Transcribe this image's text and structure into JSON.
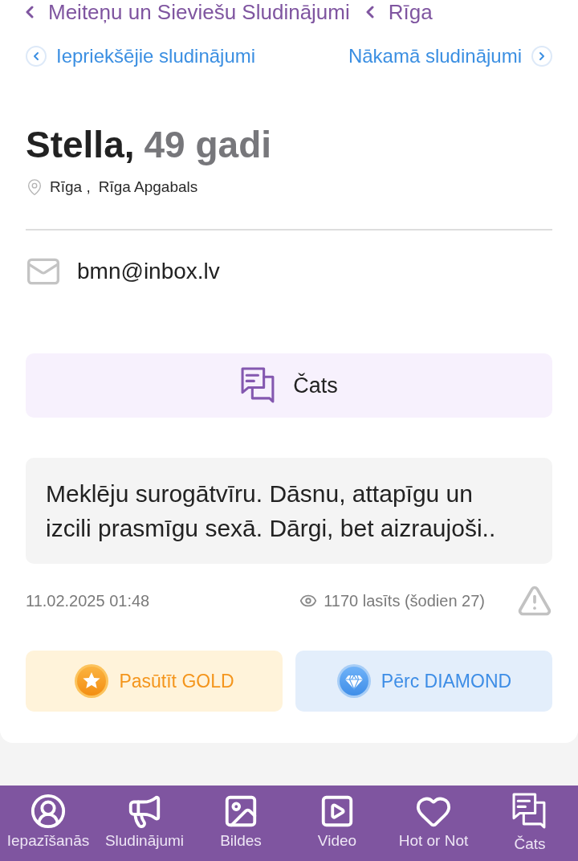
{
  "breadcrumb": [
    {
      "label": "Meiteņu un Sieviešu Sludinājumi"
    },
    {
      "label": "Rīga"
    }
  ],
  "pager": {
    "previous": "Iepriekšējie sludinājumi",
    "next": "Nākamā sludinājumi"
  },
  "profile": {
    "name": "Stella,",
    "age": "49 gadi",
    "city": "Rīga ,",
    "region": "Rīga Apgabals",
    "email": "bmn@inbox.lv"
  },
  "chat_button": {
    "label": "Čats"
  },
  "description": "Meklēju surogātvīru. Dāsnu, attapīgu un izcili prasmīgu sexā. Dārgi, bet aizraujoši..",
  "meta": {
    "date": "11.02.2025 01:48",
    "views": "1170 lasīts (šodien 27)"
  },
  "promo_buttons": [
    {
      "kind": "gold",
      "label": "Pasūtīt GOLD"
    },
    {
      "kind": "diamond",
      "label": "Pērc DIAMOND"
    }
  ],
  "bottom_nav": [
    {
      "kind": "profile",
      "label": "Iepazīšanās"
    },
    {
      "kind": "megaphone",
      "label": "Sludinājumi"
    },
    {
      "kind": "image",
      "label": "Bildes"
    },
    {
      "kind": "video",
      "label": "Video"
    },
    {
      "kind": "heart",
      "label": "Hot or Not"
    },
    {
      "kind": "chat",
      "label": "Čats"
    }
  ]
}
